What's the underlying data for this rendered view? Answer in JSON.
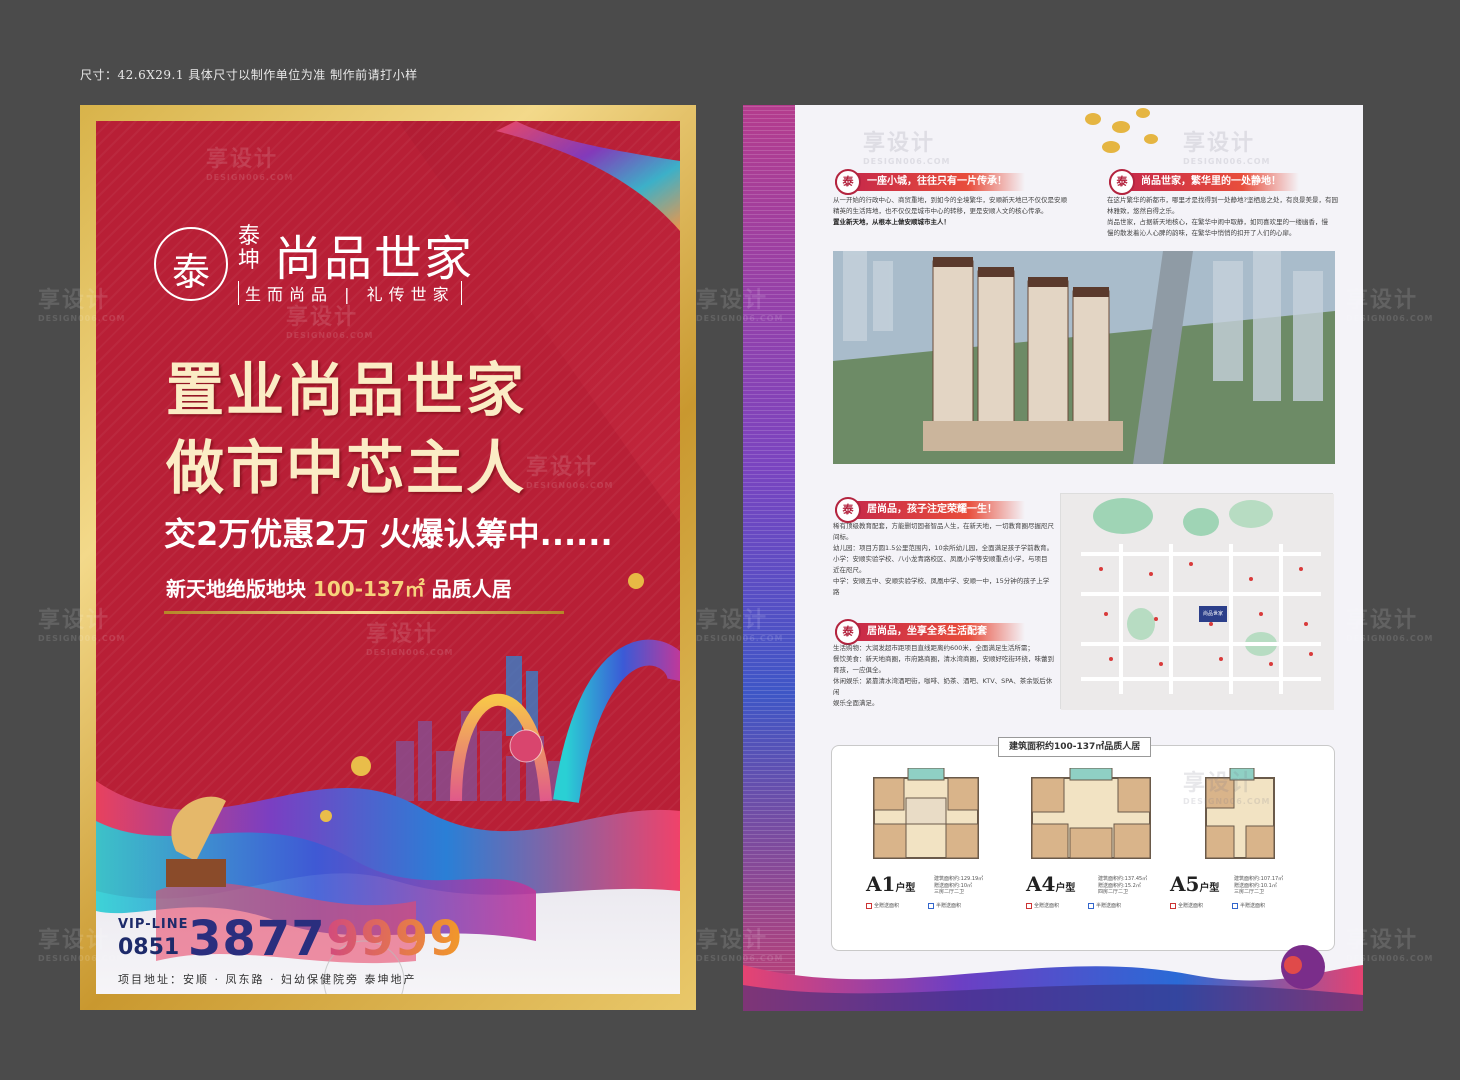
{
  "size_note": "尺寸：42.6X29.1 具体尺寸以制作单位为准 制作前请打小样",
  "front": {
    "logo_seal": "泰",
    "brand": "泰坤",
    "project_name": "尚品世家",
    "slogan": "生而尚品 | 礼传世家",
    "headline_1": "置业尚品世家",
    "headline_2": "做市中芯主人",
    "promo": "交2万优惠2万  火爆认筹中......",
    "tagline_a": "新天地绝版地块 ",
    "tagline_b": "100-137㎡",
    "tagline_c": " 品质人居",
    "vip_label": "VIP-LINE",
    "area_code": "0851",
    "phone_part1": "3877",
    "phone_part2": "9999",
    "address": "项目地址：安顺 · 凤东路 · 妇幼保健院旁    泰坤地产"
  },
  "back": {
    "seal": "泰",
    "sec1_title": "一座小城，往往只有一片传承！",
    "sec1_text": [
      "从一开始的行政中心、商贸重地，到如今的全境繁华，安顺新天地已不仅仅是安顺",
      "精英的生活阵地，也不仅仅是城市中心的转移，更是安顺人文的核心传承。"
    ],
    "sec1_bold": "置业新天地，从根本上做安顺城市主人！",
    "sec2_title": "尚品世家，繁华里的一处静地！",
    "sec2_text": [
      "在这片繁华的新都市，哪里才是找得到一处静地?坚栖息之处，有良景美景，有园",
      "林雅致，悠然自得之乐。",
      "尚品世家，占据新天地核心，在繁华中闹中取静，如同喜欢里的一缕幽香，慢",
      "慢的散发着沁人心脾的韵味，在繁华中悄悄的扣开了人们的心扉。"
    ],
    "sec3_title": "居尚品，孩子注定荣耀一生！",
    "sec3_text": [
      "稀有顶级教育配套，方能删切固者智品人生，在新天地，一切教育圈尽握咫尺",
      "间标。",
      "幼儿园：项目方圆1.5公里范围内，10余所幼儿园，全面满足孩子学前教育。",
      "小学：安顺实验学校、八小龙青路校区、凤凰小学等安顺重点小学，与项目",
      "近在咫尺。",
      "中学：安顺五中、安顺实验学校、凤凰中学、安顺一中，15分钟的孩子上学路"
    ],
    "sec4_title": "居尚品，坐享全系生活配套",
    "sec4_text": [
      "生活购物：大润发超市距项目直线距离约600米，全面满足生活所需；",
      "餐饮美食：新天地商圈，市府路商圈，清水湾商圈，安顺好吃街环绕，味蕾到",
      "育孩，一应俱全。",
      "休闲娱乐：紧靠清水湾酒吧街，咖啡、奶茶、酒吧、KTV、SPA、茶余饭后休闲",
      "娱乐全面满足。"
    ],
    "plans_title": "建筑面积约100-137㎡品质人居",
    "plans": [
      {
        "name": "A1",
        "suffix": "户型",
        "spec": [
          "建筑面积约:129.19㎡",
          "赠送面积约:10㎡",
          "三房二厅二卫"
        ]
      },
      {
        "name": "A4",
        "suffix": "户型",
        "spec": [
          "建筑面积约:137.45㎡",
          "赠送面积约:15.2㎡",
          "四房二厅二卫"
        ]
      },
      {
        "name": "A5",
        "suffix": "户型",
        "spec": [
          "建筑面积约:107.17㎡",
          "赠送面积约:10.1㎡",
          "三房二厅二卫"
        ]
      }
    ],
    "legend_full": "全赠送面积",
    "legend_half": "半赠送面积",
    "map_center_label": "尚品世家"
  },
  "watermark": {
    "text": "享设计",
    "sub": "DESIGN006.COM"
  }
}
